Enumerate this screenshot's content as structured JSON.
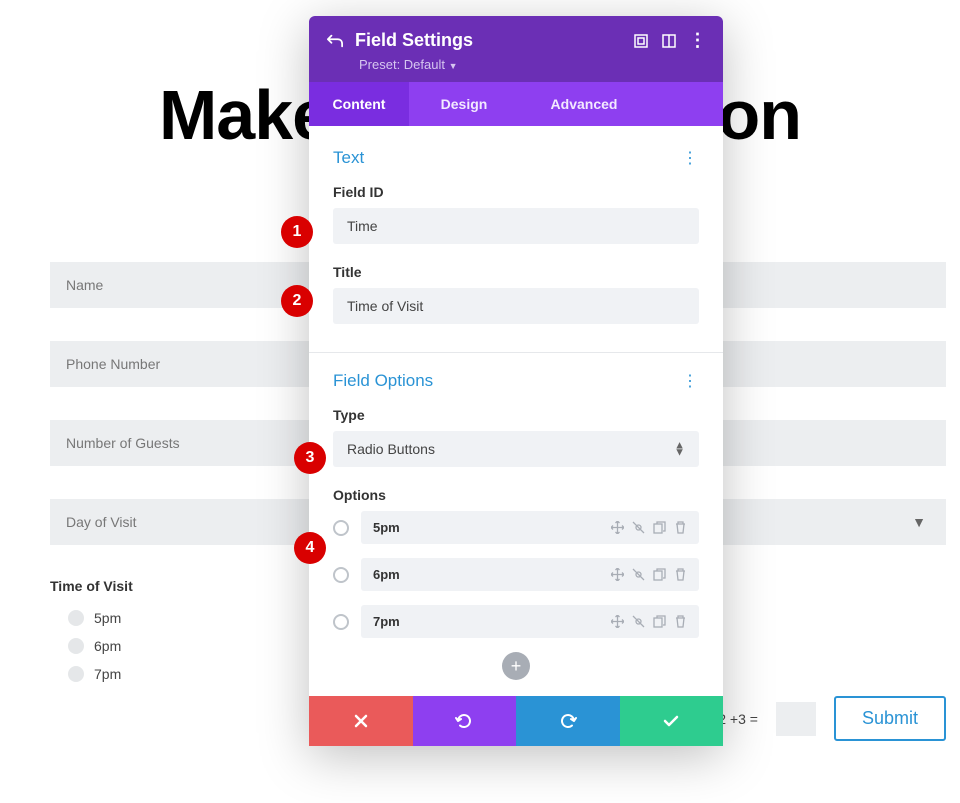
{
  "bg": {
    "title": "Make A Reservation",
    "fields": [
      "Name",
      "Phone Number",
      "Number of Guests",
      "Day of Visit"
    ],
    "time_label": "Time of Visit",
    "time_options": [
      "5pm",
      "6pm",
      "7pm"
    ],
    "captcha": "12 +3 =",
    "submit": "Submit"
  },
  "modal": {
    "title": "Field Settings",
    "preset": "Preset: Default",
    "tabs": {
      "content": "Content",
      "design": "Design",
      "advanced": "Advanced"
    },
    "text_section": {
      "title": "Text",
      "field_id_label": "Field ID",
      "field_id_value": "Time",
      "title_label": "Title",
      "title_value": "Time of Visit"
    },
    "options_section": {
      "title": "Field Options",
      "type_label": "Type",
      "type_value": "Radio Buttons",
      "options_label": "Options",
      "options": [
        "5pm",
        "6pm",
        "7pm"
      ]
    }
  },
  "callouts": [
    "1",
    "2",
    "3",
    "4"
  ]
}
